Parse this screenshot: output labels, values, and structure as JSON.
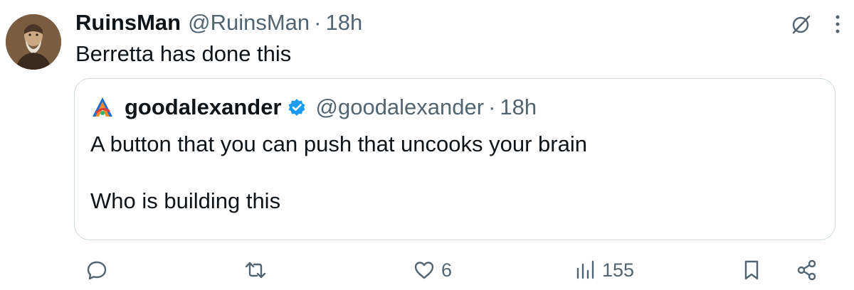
{
  "tweet": {
    "author": {
      "display_name": "RuinsMan",
      "handle": "@RuinsMan",
      "time": "18h"
    },
    "text": "Berretta has done this",
    "separator": "·"
  },
  "quoted_tweet": {
    "author": {
      "display_name": "goodalexander",
      "handle": "@goodalexander",
      "time": "18h",
      "verified": true
    },
    "text": "A button that you can push that uncooks your brain\n\nWho is building this",
    "separator": "·"
  },
  "actions": {
    "reply": {
      "icon": "reply-icon",
      "count": ""
    },
    "repost": {
      "icon": "repost-icon",
      "count": ""
    },
    "like": {
      "icon": "heart-icon",
      "count": "6"
    },
    "views": {
      "icon": "views-icon",
      "count": "155"
    },
    "bookmark": {
      "icon": "bookmark-icon"
    },
    "share": {
      "icon": "share-icon"
    }
  },
  "top_icons": [
    "grok-icon",
    "more-icon"
  ],
  "colors": {
    "text_primary": "#0f1419",
    "text_secondary": "#536471",
    "border": "#cfd9de",
    "verified_blue": "#1d9bf0"
  }
}
